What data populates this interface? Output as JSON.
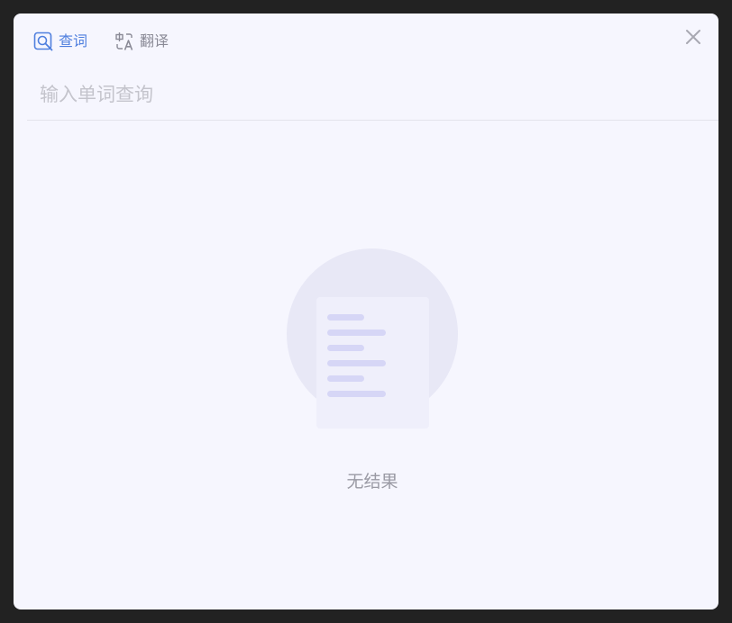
{
  "tabs": [
    {
      "label": "查词",
      "icon": "search-book-icon",
      "active": true
    },
    {
      "label": "翻译",
      "icon": "translate-icon",
      "active": false
    }
  ],
  "search": {
    "placeholder": "输入单词查询",
    "value": ""
  },
  "empty_state": {
    "message": "无结果",
    "icon": "empty-document-icon"
  },
  "colors": {
    "accent": "#4f7fde",
    "background": "#f6f6fe",
    "illustration_circle": "#e8e8f6",
    "illustration_lines": "#d6d6f6"
  }
}
